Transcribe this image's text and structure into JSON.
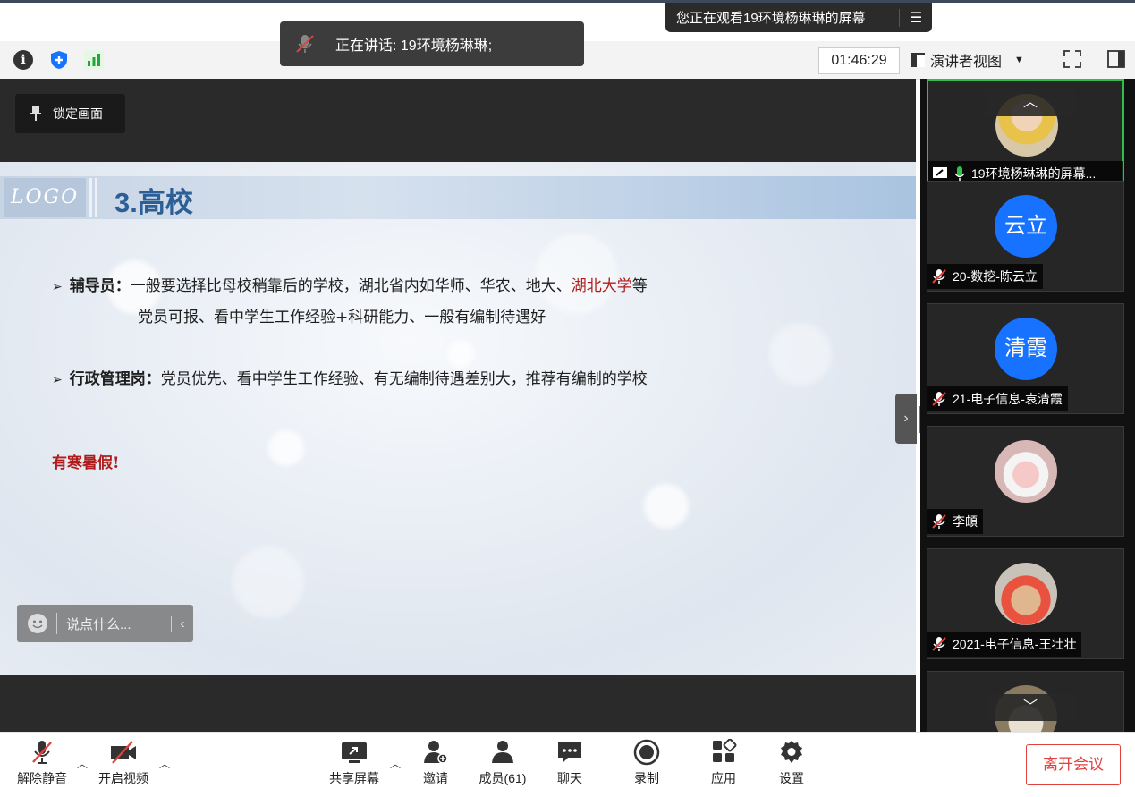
{
  "banner": {
    "watching_text": "您正在观看19环境杨琳琳的屏幕",
    "menu_icon": "list-icon"
  },
  "toast": {
    "speaking_text": "正在讲话: 19环境杨琳琳;"
  },
  "status": {
    "timer": "01:46:29",
    "view_mode": "演讲者视图"
  },
  "main": {
    "lock_label": "锁定画面"
  },
  "slide": {
    "logo": "LOGO",
    "title": "3.高校",
    "bullet1_heading": "辅导员：",
    "bullet1_text_a": "一般要选择比母校稍靠后的学校，湖北省内如华师、华农、地大、",
    "bullet1_highlight": "湖北大学",
    "bullet1_text_b": "等",
    "bullet1_line2": "党员可报、看中学生工作经验+科研能力、一般有编制待遇好",
    "bullet2_heading": "行政管理岗：",
    "bullet2_text": "党员优先、看中学生工作经验、有无编制待遇差别大，推荐有编制的学校",
    "note": "有寒暑假!"
  },
  "chat": {
    "placeholder": "说点什么..."
  },
  "participants": [
    {
      "name": "19环境杨琳琳的屏幕...",
      "avatar": "photo",
      "mic": "on",
      "sharing": true
    },
    {
      "name": "20-数挖-陈云立",
      "avatar_text": "云立",
      "mic": "muted"
    },
    {
      "name": "21-电子信息-袁清霞",
      "avatar_text": "清霞",
      "mic": "muted"
    },
    {
      "name": "李頔",
      "avatar": "photo",
      "mic": "muted"
    },
    {
      "name": "2021-电子信息-王壮壮",
      "avatar": "photo",
      "mic": "muted"
    }
  ],
  "toolbar": {
    "unmute": "解除静音",
    "video": "开启视频",
    "share": "共享屏幕",
    "invite": "邀请",
    "members": "成员(61)",
    "chat": "聊天",
    "record": "录制",
    "apps": "应用",
    "settings": "设置",
    "leave": "离开会议"
  },
  "colors": {
    "accent_green": "#2fbf4a",
    "leave_red": "#e0413c",
    "avatar_blue": "#1672ff"
  }
}
